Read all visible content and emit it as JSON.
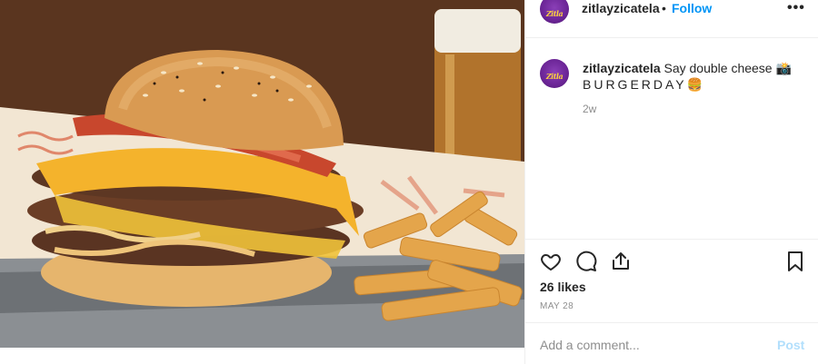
{
  "post": {
    "image_alt": "Triple cheeseburger with bacon and fries on a metal tray",
    "username": "zitlayzicatela",
    "avatar_text": "Zitla",
    "follow_label": "Follow",
    "separator": "•",
    "more_label": "•••"
  },
  "caption": {
    "username": "zitlayzicatela",
    "text_line1": "Say double cheese 📸",
    "text_line2": "BURGERDAY🍔",
    "time_ago": "2w"
  },
  "actions": {
    "likes": "26 likes",
    "date": "MAY 28",
    "icons": [
      "heart-icon",
      "comment-icon",
      "share-icon",
      "bookmark-icon"
    ]
  },
  "comment_box": {
    "placeholder": "Add a comment...",
    "post_label": "Post"
  },
  "colors": {
    "link_blue": "#0095f6",
    "post_disabled": "#b2dffc",
    "avatar_purple": "#6b2596",
    "muted_text": "#8e8e8e"
  }
}
